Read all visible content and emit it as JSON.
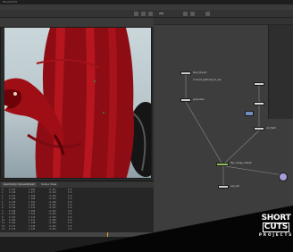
{
  "window": {
    "title": "Houdini FX"
  },
  "toolbar": {
    "path_label": "obj",
    "zoom_label": "1.0"
  },
  "node_graph": {
    "nodes": [
      {
        "label": "fluid_import"
      },
      {
        "label": "convert_particles_to_vel"
      },
      {
        "label": "popsolver"
      },
      {
        "label": "vel_field"
      },
      {
        "label": "flip_merge_output"
      },
      {
        "label": "out_sim"
      }
    ]
  },
  "sheet": {
    "tabs": [
      "Geometry Spreadsheet",
      "Scene View"
    ],
    "rows": [
      [
        "0",
        "0.123",
        "1.482",
        "-0.221",
        "0.0"
      ],
      [
        "1",
        "0.118",
        "1.477",
        "-0.219",
        "0.0"
      ],
      [
        "2",
        "0.131",
        "1.490",
        "-0.230",
        "0.0"
      ],
      [
        "3",
        "0.126",
        "1.486",
        "-0.225",
        "0.0"
      ],
      [
        "4",
        "0.140",
        "1.501",
        "-0.238",
        "0.0"
      ],
      [
        "5",
        "0.137",
        "1.497",
        "-0.233",
        "0.0"
      ],
      [
        "6",
        "0.149",
        "1.512",
        "-0.245",
        "0.0"
      ],
      [
        "7",
        "0.144",
        "1.506",
        "-0.241",
        "0.0"
      ],
      [
        "8",
        "0.158",
        "1.523",
        "-0.252",
        "0.0"
      ],
      [
        "9",
        "0.155",
        "1.519",
        "-0.249",
        "0.0"
      ],
      [
        "10",
        "0.166",
        "1.531",
        "-0.260",
        "0.0"
      ],
      [
        "11",
        "0.162",
        "1.528",
        "-0.256",
        "0.0"
      ],
      [
        "12",
        "0.173",
        "1.540",
        "-0.267",
        "0.0"
      ],
      [
        "13",
        "0.170",
        "1.536",
        "-0.263",
        "0.0"
      ]
    ]
  },
  "logo": {
    "line1": "SHORT",
    "line2": "CUTS",
    "line3": "PROJECTS"
  },
  "colors": {
    "accent": "#f0a020",
    "blood": "#9b0e16",
    "node_active": "#8dbf5a"
  }
}
